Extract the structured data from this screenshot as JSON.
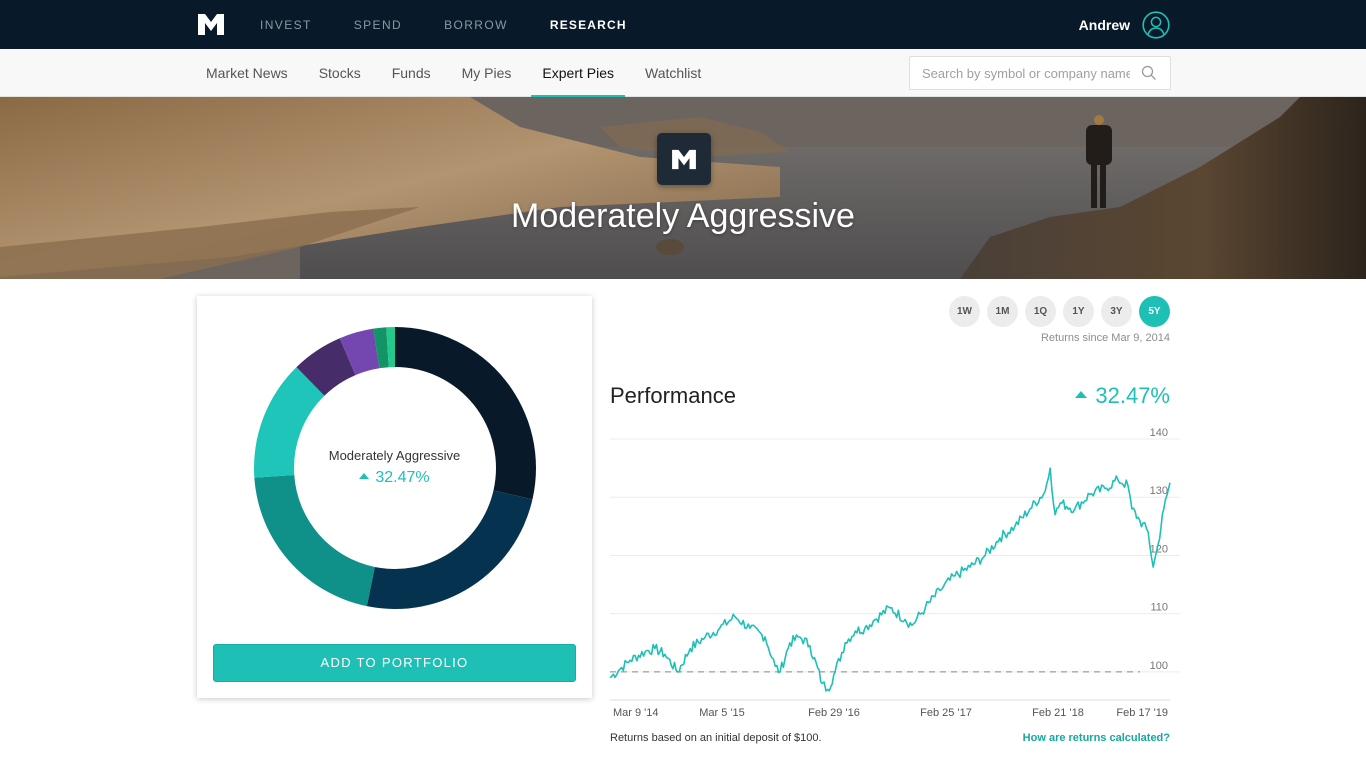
{
  "topbar": {
    "logo": "m1-logo-icon",
    "nav": [
      {
        "label": "INVEST",
        "active": false
      },
      {
        "label": "SPEND",
        "active": false
      },
      {
        "label": "BORROW",
        "active": false
      },
      {
        "label": "RESEARCH",
        "active": true
      }
    ],
    "user_name": "Andrew",
    "user_icon": "user-avatar-icon"
  },
  "subnav": {
    "items": [
      {
        "label": "Market News",
        "active": false
      },
      {
        "label": "Stocks",
        "active": false
      },
      {
        "label": "Funds",
        "active": false
      },
      {
        "label": "My Pies",
        "active": false
      },
      {
        "label": "Expert Pies",
        "active": true
      },
      {
        "label": "Watchlist",
        "active": false
      }
    ],
    "search": {
      "placeholder": "Search by symbol or company name",
      "value": "",
      "icon": "search-icon"
    }
  },
  "hero": {
    "badge_icon": "m1-logo-icon",
    "title": "Moderately Aggressive"
  },
  "pie": {
    "center_title": "Moderately Aggressive",
    "center_return": "32.47%",
    "slices": [
      {
        "color": "#081a29",
        "value": 29
      },
      {
        "color": "#05324f",
        "value": 25
      },
      {
        "color": "#0f9189",
        "value": 21
      },
      {
        "color": "#1ec5b8",
        "value": 14
      },
      {
        "color": "#472c6a",
        "value": 6
      },
      {
        "color": "#7447b0",
        "value": 4
      },
      {
        "color": "#129466",
        "value": 1.5
      },
      {
        "color": "#22c98a",
        "value": 1
      }
    ],
    "add_button": "ADD TO PORTFOLIO"
  },
  "ranges": {
    "options": [
      "1W",
      "1M",
      "1Q",
      "1Y",
      "3Y",
      "5Y"
    ],
    "selected": "5Y",
    "returns_since": "Returns since Mar 9, 2014"
  },
  "performance": {
    "title": "Performance",
    "value": "32.47%",
    "note": "Returns based on an initial deposit of $100.",
    "link": "How are returns calculated?"
  },
  "colors": {
    "accent": "#1ec0b5",
    "navy": "#081a29"
  },
  "chart_data": {
    "type": "line",
    "title": "Performance",
    "xlabel": "",
    "ylabel": "",
    "ylim": [
      95,
      140
    ],
    "yticks": [
      100,
      110,
      120,
      130,
      140
    ],
    "xticks": [
      "Mar 9 '14",
      "Mar 5 '15",
      "Feb 29 '16",
      "Feb 25 '17",
      "Feb 21 '18",
      "Feb 17 '19"
    ],
    "xtick_positions": [
      0.0,
      0.2,
      0.4,
      0.6,
      0.8,
      1.0
    ],
    "baseline": 100,
    "grid": true,
    "series": [
      {
        "name": "Moderately Aggressive",
        "color": "#1ec0b5",
        "x": [
          0.0,
          0.018,
          0.036,
          0.063,
          0.08,
          0.098,
          0.121,
          0.143,
          0.17,
          0.196,
          0.223,
          0.25,
          0.277,
          0.295,
          0.304,
          0.321,
          0.339,
          0.357,
          0.379,
          0.389,
          0.402,
          0.42,
          0.438,
          0.455,
          0.473,
          0.5,
          0.527,
          0.539,
          0.563,
          0.589,
          0.616,
          0.643,
          0.67,
          0.696,
          0.723,
          0.75,
          0.777,
          0.786,
          0.795,
          0.804,
          0.83,
          0.857,
          0.884,
          0.907,
          0.925,
          0.932,
          0.946,
          0.961,
          0.97,
          0.979,
          0.989,
          1.0
        ],
        "values": [
          99,
          100.5,
          102,
          103.5,
          104,
          103,
          100,
          104,
          106,
          107.5,
          109.5,
          107.5,
          106,
          101,
          100,
          105,
          106,
          104.5,
          98,
          97,
          100,
          105,
          107,
          107.5,
          109,
          111,
          109,
          108,
          111,
          114,
          116.5,
          118,
          120,
          123,
          125,
          128,
          131,
          135,
          127,
          129,
          128,
          130.5,
          131.5,
          133,
          132,
          128,
          126,
          124,
          118,
          122,
          128,
          132.5
        ]
      }
    ]
  }
}
